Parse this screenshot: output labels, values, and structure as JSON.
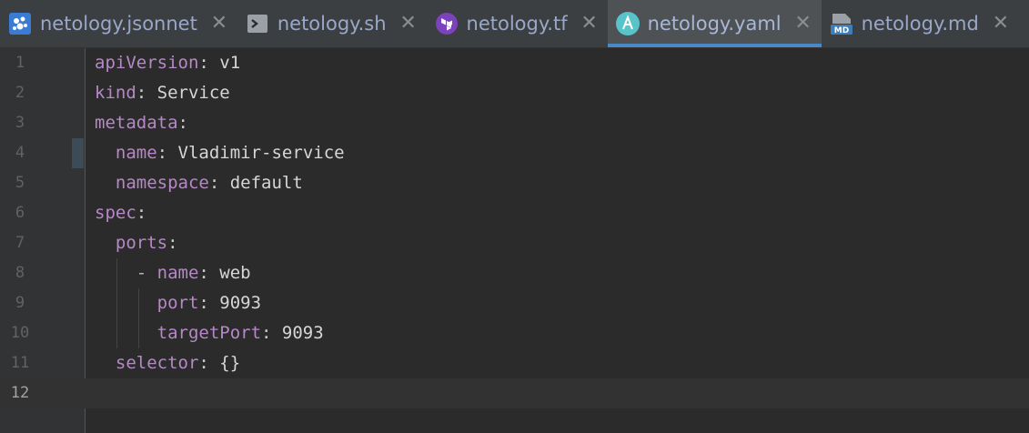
{
  "tabs": [
    {
      "label": "netology.jsonnet",
      "icon": "jsonnet-icon",
      "active": false
    },
    {
      "label": "netology.sh",
      "icon": "shell-script-icon",
      "active": false
    },
    {
      "label": "netology.tf",
      "icon": "terraform-icon",
      "active": false
    },
    {
      "label": "netology.yaml",
      "icon": "ansible-icon",
      "active": true
    },
    {
      "label": "netology.md",
      "icon": "markdown-icon",
      "active": false
    }
  ],
  "close_glyph": "✕",
  "editor": {
    "lines": [
      {
        "num": "1",
        "indent": "",
        "key": "apiVersion",
        "sep": ": ",
        "value": "v1"
      },
      {
        "num": "2",
        "indent": "",
        "key": "kind",
        "sep": ": ",
        "value": "Service"
      },
      {
        "num": "3",
        "indent": "",
        "key": "metadata",
        "sep": ":",
        "value": ""
      },
      {
        "num": "4",
        "indent": "  ",
        "key": "name",
        "sep": ": ",
        "value": "Vladimir-service"
      },
      {
        "num": "5",
        "indent": "  ",
        "key": "namespace",
        "sep": ": ",
        "value": "default"
      },
      {
        "num": "6",
        "indent": "",
        "key": "spec",
        "sep": ":",
        "value": ""
      },
      {
        "num": "7",
        "indent": "  ",
        "key": "ports",
        "sep": ":",
        "value": ""
      },
      {
        "num": "8",
        "indent": "    - ",
        "key": "name",
        "sep": ": ",
        "value": "web"
      },
      {
        "num": "9",
        "indent": "      ",
        "key": "port",
        "sep": ": ",
        "value": "9093"
      },
      {
        "num": "10",
        "indent": "      ",
        "key": "targetPort",
        "sep": ": ",
        "value": "9093"
      },
      {
        "num": "11",
        "indent": "  ",
        "key": "selector",
        "sep": ": ",
        "value": "{}"
      },
      {
        "num": "12",
        "indent": "",
        "key": "",
        "sep": "",
        "value": ""
      }
    ],
    "current_line": "12"
  },
  "colors": {
    "background": "#2b2b2b",
    "gutter": "#313335",
    "key": "#b788c7",
    "value": "#d6d6d6",
    "active_tab_underline": "#4a88c7"
  }
}
